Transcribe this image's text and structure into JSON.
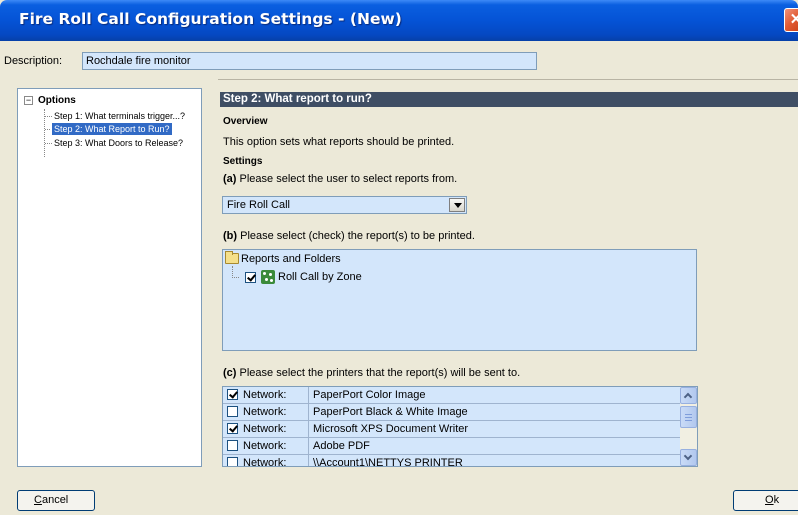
{
  "window": {
    "title": "Fire Roll Call Configuration Settings - (New)",
    "close_glyph": "✕"
  },
  "description": {
    "label": "Description:",
    "value": "Rochdale fire monitor"
  },
  "tree": {
    "expander_glyph": "−",
    "root_label": "Options",
    "items": [
      {
        "label": "Step 1: What terminals trigger...?",
        "selected": false
      },
      {
        "label": "Step 2: What Report to Run?",
        "selected": true
      },
      {
        "label": "Step 3: What Doors to Release?",
        "selected": false
      }
    ]
  },
  "content": {
    "step_title": "Step 2: What report to run?",
    "overview_heading": "Overview",
    "overview_text": "This option sets what reports should be printed.",
    "settings_heading": "Settings",
    "a_prefix": "(a)",
    "a_text": "Please select the user to select reports from.",
    "user_select_value": "Fire Roll Call",
    "b_prefix": "(b)",
    "b_text": "Please select (check) the report(s) to be printed.",
    "reports_folder": "Reports and Folders",
    "report_item": {
      "label": "Roll Call by Zone",
      "checked": true
    },
    "c_prefix": "(c)",
    "c_text": "Please select the printers that the report(s) will be sent to.",
    "printers": [
      {
        "type": "Network:",
        "name": "PaperPort Color Image",
        "checked": true
      },
      {
        "type": "Network:",
        "name": "PaperPort Black & White Image",
        "checked": false
      },
      {
        "type": "Network:",
        "name": "Microsoft XPS Document Writer",
        "checked": true
      },
      {
        "type": "Network:",
        "name": "Adobe PDF",
        "checked": false
      },
      {
        "type": "Network:",
        "name": "\\\\Account1\\NETTYS PRINTER",
        "checked": false
      }
    ]
  },
  "buttons": {
    "cancel_mnemonic": "C",
    "cancel_rest": "ancel",
    "ok_mnemonic": "O",
    "ok_rest": "k"
  },
  "colors": {
    "titlebar": "#0553d6",
    "header_bar": "#3f4e64",
    "selection": "#316ac5",
    "field_bg": "#d3e6fb"
  }
}
